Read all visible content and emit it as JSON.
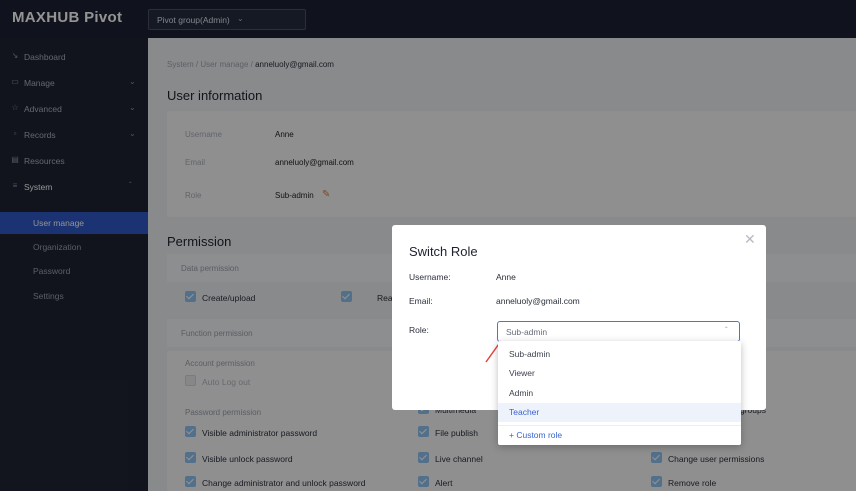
{
  "app": {
    "brand": "MAXHUB Pivot",
    "group_selector": "Pivot group(Admin)"
  },
  "sidebar": {
    "items": [
      {
        "icon": "dashboard-icon",
        "label": "Dashboard",
        "has_arrow": false
      },
      {
        "icon": "monitor-icon",
        "label": "Manage",
        "has_arrow": true
      },
      {
        "icon": "star-icon",
        "label": "Advanced",
        "has_arrow": true
      },
      {
        "icon": "records-icon",
        "label": "Records",
        "has_arrow": true
      },
      {
        "icon": "resources-icon",
        "label": "Resources",
        "has_arrow": false
      },
      {
        "icon": "system-icon",
        "label": "System",
        "has_arrow": true,
        "expanded": true
      }
    ],
    "system_sub": [
      {
        "label": "User manage",
        "active": true
      },
      {
        "label": "Organization"
      },
      {
        "label": "Password"
      },
      {
        "label": "Settings"
      }
    ]
  },
  "breadcrumb": {
    "part1": "System",
    "sep": "/",
    "part2": "User manage",
    "current": "anneluoly@gmail.com"
  },
  "user_info": {
    "title": "User information",
    "username_label": "Username",
    "username": "Anne",
    "email_label": "Email",
    "email": "anneluoly@gmail.com",
    "role_label": "Role",
    "role": "Sub-admin"
  },
  "permission": {
    "title": "Permission",
    "data_permission": "Data permission",
    "create_upload": "Create/upload",
    "read": "Read",
    "function_permission": "Function permission",
    "account_permission": "Account permission",
    "auto_log_out": "Auto Log out",
    "password_permission": "Password permission",
    "visible_admin_password": "Visible administrator password",
    "visible_unlock_password": "Visible unlock password",
    "change_admin_unlock_password": "Change administrator and unlock password",
    "multimedia": "Multimedia",
    "file_publish": "File publish",
    "live_channel": "Live channel",
    "alert": "Alert",
    "groups": "groups",
    "change_user_permissions": "Change user permissions",
    "remove_role": "Remove role"
  },
  "modal": {
    "title": "Switch Role",
    "username_label": "Username:",
    "username": "Anne",
    "email_label": "Email:",
    "email": "anneluoly@gmail.com",
    "role_label": "Role:",
    "role_value": "Sub-admin",
    "options": [
      "Sub-admin",
      "Viewer",
      "Admin",
      "Teacher"
    ],
    "highlighted": "Teacher",
    "add_custom": "+ Custom role"
  },
  "colors": {
    "accent": "#2f57c6",
    "topbar": "#1d2233",
    "checkbox": "#8fc1ee",
    "annotation": "#e0473f"
  }
}
